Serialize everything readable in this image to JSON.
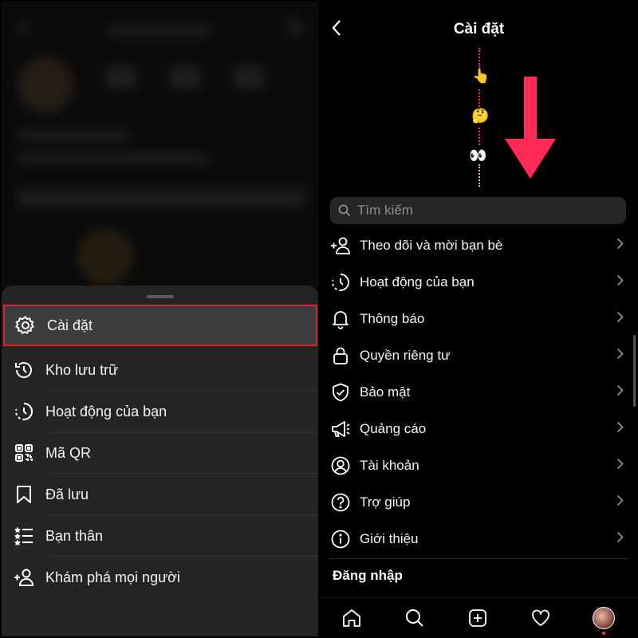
{
  "left_panel": {
    "menu": [
      {
        "label": "Cài đặt",
        "icon": "gear-icon",
        "active": true
      },
      {
        "label": "Kho lưu trữ",
        "icon": "archive-icon"
      },
      {
        "label": "Hoạt động của bạn",
        "icon": "activity-icon"
      },
      {
        "label": "Mã QR",
        "icon": "qr-icon"
      },
      {
        "label": "Đã lưu",
        "icon": "bookmark-icon"
      },
      {
        "label": "Bạn thân",
        "icon": "close-friends-icon"
      },
      {
        "label": "Khám phá mọi người",
        "icon": "add-person-icon"
      }
    ],
    "highlight_color": "#d8262e"
  },
  "right_panel": {
    "title": "Cài đặt",
    "search": {
      "placeholder": "Tìm kiếm"
    },
    "items": [
      {
        "label": "Theo dõi và mời bạn bè",
        "icon": "add-person-icon"
      },
      {
        "label": "Hoạt động của bạn",
        "icon": "activity-icon"
      },
      {
        "label": "Thông báo",
        "icon": "bell-icon"
      },
      {
        "label": "Quyền riêng tư",
        "icon": "lock-icon"
      },
      {
        "label": "Bảo mật",
        "icon": "shield-icon"
      },
      {
        "label": "Quảng cáo",
        "icon": "megaphone-icon"
      },
      {
        "label": "Tài khoản",
        "icon": "account-icon"
      },
      {
        "label": "Trợ giúp",
        "icon": "help-icon"
      },
      {
        "label": "Giới thiệu",
        "icon": "info-icon"
      }
    ],
    "section_login": "Đăng nhập",
    "emojis": [
      "👆",
      "🤔",
      "👀"
    ],
    "arrow_color": "#ff2a55",
    "bottom_nav": [
      "home-icon",
      "search-icon",
      "create-icon",
      "heart-icon",
      "profile-avatar"
    ]
  }
}
